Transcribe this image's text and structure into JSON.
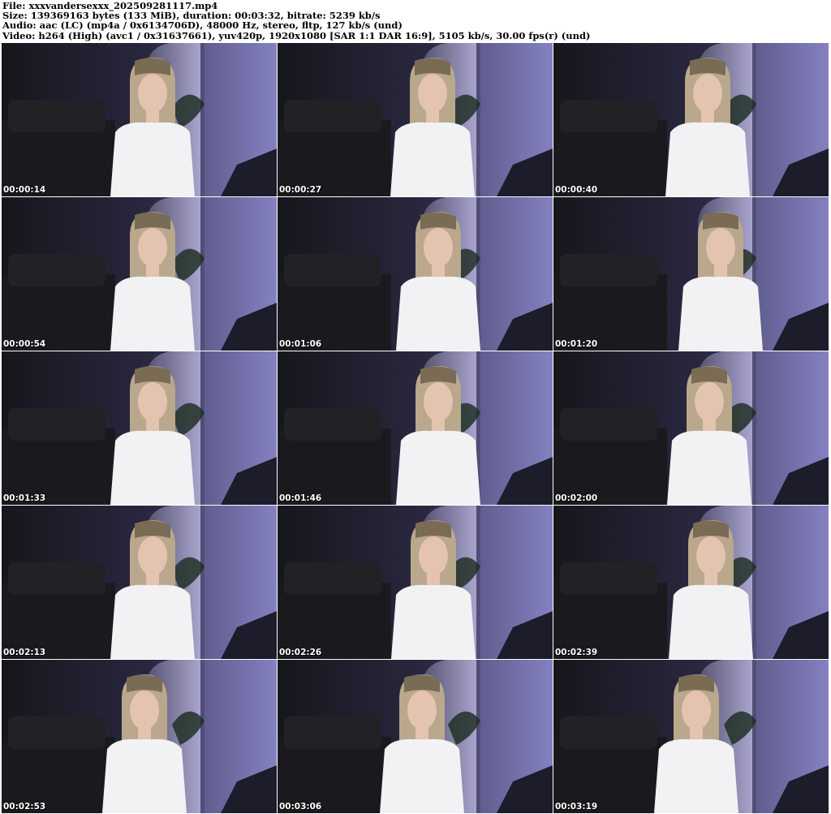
{
  "header": {
    "file_line": "File: xxxvandersexxx_202509281117.mp4",
    "size_line": "Size: 139369163 bytes (133 MiB), duration: 00:03:32, bitrate: 5239 kb/s",
    "audio_line": "Audio: aac (LC) (mp4a / 0x6134706D), 48000 Hz, stereo, fltp, 127 kb/s (und)",
    "video_line": "Video: h264 (High) (avc1 / 0x31637661), yuv420p, 1920x1080 [SAR 1:1 DAR 16:9], 5105 kb/s, 30.00 fps(r) (und)"
  },
  "thumbnails": [
    {
      "timestamp": "00:00:14"
    },
    {
      "timestamp": "00:00:27"
    },
    {
      "timestamp": "00:00:40"
    },
    {
      "timestamp": "00:00:54"
    },
    {
      "timestamp": "00:01:06"
    },
    {
      "timestamp": "00:01:20"
    },
    {
      "timestamp": "00:01:33"
    },
    {
      "timestamp": "00:01:46"
    },
    {
      "timestamp": "00:02:00"
    },
    {
      "timestamp": "00:02:13"
    },
    {
      "timestamp": "00:02:26"
    },
    {
      "timestamp": "00:02:39"
    },
    {
      "timestamp": "00:02:53"
    },
    {
      "timestamp": "00:03:06"
    },
    {
      "timestamp": "00:03:19"
    }
  ],
  "colors": {
    "wall_light": "#8a86c8",
    "wall_dark": "#2a2840",
    "sofa": "#1a1a1e",
    "shirt": "#f2f2f4",
    "hair": "#b9a88c",
    "skin": "#e4c3b0"
  }
}
